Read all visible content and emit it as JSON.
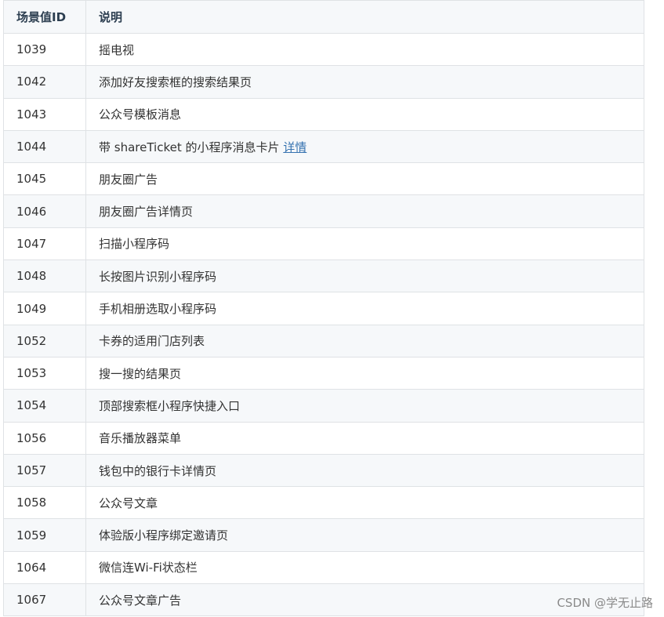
{
  "table": {
    "headers": [
      "场景值ID",
      "说明"
    ],
    "rows": [
      {
        "id": "1039",
        "desc": "摇电视"
      },
      {
        "id": "1042",
        "desc": "添加好友搜索框的搜索结果页"
      },
      {
        "id": "1043",
        "desc": "公众号模板消息"
      },
      {
        "id": "1044",
        "desc": "带 shareTicket 的小程序消息卡片 ",
        "link": "详情"
      },
      {
        "id": "1045",
        "desc": "朋友圈广告"
      },
      {
        "id": "1046",
        "desc": "朋友圈广告详情页"
      },
      {
        "id": "1047",
        "desc": "扫描小程序码"
      },
      {
        "id": "1048",
        "desc": "长按图片识别小程序码"
      },
      {
        "id": "1049",
        "desc": "手机相册选取小程序码"
      },
      {
        "id": "1052",
        "desc": "卡券的适用门店列表"
      },
      {
        "id": "1053",
        "desc": "搜一搜的结果页"
      },
      {
        "id": "1054",
        "desc": "顶部搜索框小程序快捷入口"
      },
      {
        "id": "1056",
        "desc": "音乐播放器菜单"
      },
      {
        "id": "1057",
        "desc": "钱包中的银行卡详情页"
      },
      {
        "id": "1058",
        "desc": "公众号文章"
      },
      {
        "id": "1059",
        "desc": "体验版小程序绑定邀请页"
      },
      {
        "id": "1064",
        "desc": "微信连Wi-Fi状态栏"
      },
      {
        "id": "1067",
        "desc": "公众号文章广告"
      }
    ]
  },
  "watermark": "CSDN @学无止路",
  "colors": {
    "header_bg": "#f6f8fa",
    "stripe_bg": "#f6f8fa",
    "border": "#dfe2e5",
    "link": "#3572b0"
  }
}
